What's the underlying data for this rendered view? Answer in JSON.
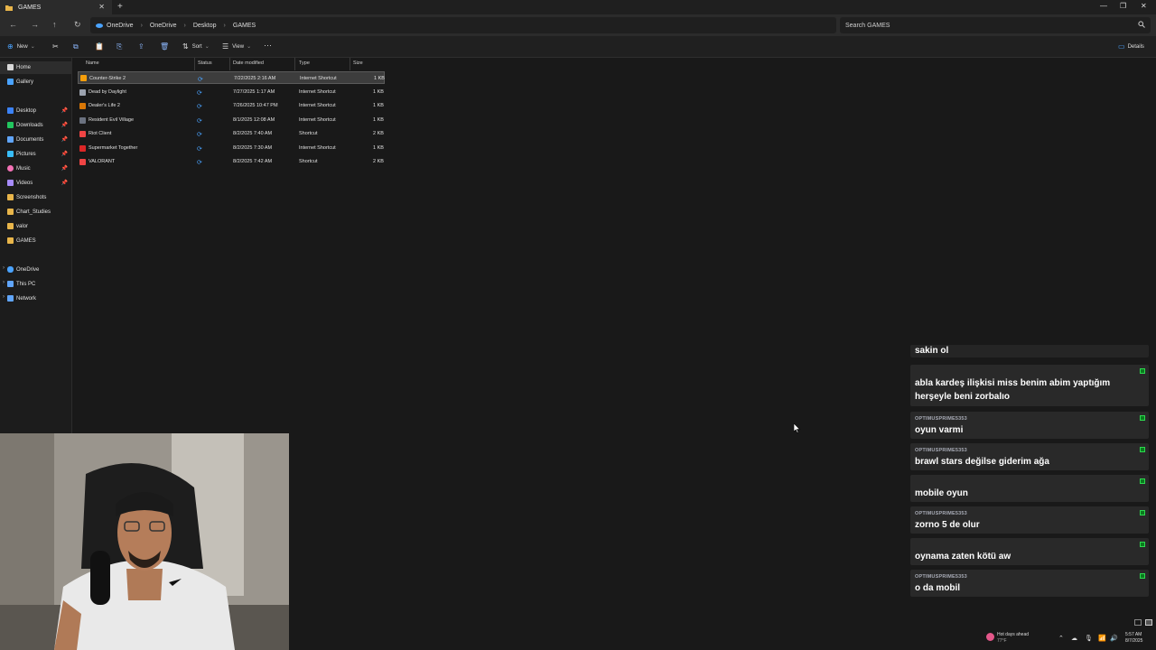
{
  "window": {
    "tab_title": "GAMES",
    "new_tab": "+",
    "tab_close": "✕",
    "minimize": "—",
    "maximize": "❐",
    "close": "✕"
  },
  "address": {
    "segments": [
      "OneDrive",
      "OneDrive",
      "Desktop",
      "GAMES"
    ],
    "search_placeholder": "Search GAMES"
  },
  "commands": {
    "new": "New",
    "sort": "Sort",
    "view": "View",
    "more": "···",
    "details": "Details"
  },
  "nav": {
    "items": [
      {
        "label": "Home",
        "color": "#d9d9d9"
      },
      {
        "label": "Gallery",
        "color": "#4aa3ff"
      },
      {
        "label": "Desktop",
        "color": "#3b82f6"
      },
      {
        "label": "Downloads",
        "color": "#22c55e"
      },
      {
        "label": "Documents",
        "color": "#60a5fa"
      },
      {
        "label": "Pictures",
        "color": "#38bdf8"
      },
      {
        "label": "Music",
        "color": "#f472b6"
      },
      {
        "label": "Videos",
        "color": "#a78bfa"
      },
      {
        "label": "Screenshots",
        "color": "#e8b54a"
      },
      {
        "label": "Chart_Studies",
        "color": "#e8b54a"
      },
      {
        "label": "valor",
        "color": "#e8b54a"
      },
      {
        "label": "GAMES",
        "color": "#e8b54a"
      },
      {
        "label": "OneDrive",
        "color": "#4aa3ff"
      },
      {
        "label": "This PC",
        "color": "#60a5fa"
      },
      {
        "label": "Network",
        "color": "#60a5fa"
      }
    ]
  },
  "columns": {
    "name": "Name",
    "status": "Status",
    "date": "Date modified",
    "type": "Type",
    "size": "Size"
  },
  "files": [
    {
      "name": "Counter-Strike 2",
      "date": "7/22/2025 2:16 AM",
      "type": "Internet Shortcut",
      "size": "1 KB",
      "color": "#f59e0b"
    },
    {
      "name": "Dead by Daylight",
      "date": "7/27/2025 1:17 AM",
      "type": "Internet Shortcut",
      "size": "1 KB",
      "color": "#9ca3af"
    },
    {
      "name": "Dealer's Life 2",
      "date": "7/26/2025 10:47 PM",
      "type": "Internet Shortcut",
      "size": "1 KB",
      "color": "#d97706"
    },
    {
      "name": "Resident Evil Village",
      "date": "8/1/2025 12:08 AM",
      "type": "Internet Shortcut",
      "size": "1 KB",
      "color": "#6b7280"
    },
    {
      "name": "Riot Client",
      "date": "8/2/2025 7:40 AM",
      "type": "Shortcut",
      "size": "2 KB",
      "color": "#ef4444"
    },
    {
      "name": "Supermarket Together",
      "date": "8/2/2025 7:30 AM",
      "type": "Internet Shortcut",
      "size": "1 KB",
      "color": "#dc2626"
    },
    {
      "name": "VALORANT",
      "date": "8/2/2025 7:42 AM",
      "type": "Shortcut",
      "size": "2 KB",
      "color": "#ef4444"
    }
  ],
  "chat": {
    "partial_top": "sakin ol",
    "messages": [
      {
        "user": "",
        "user_red": true,
        "text": "abla kardeş ilişkisi miss benim abim yaptığım herşeyle beni zorbalıo"
      },
      {
        "user": "OPTIMUSPRIME5353",
        "user_red": false,
        "text": "oyun varmi"
      },
      {
        "user": "OPTIMUSPRIME5353",
        "user_red": false,
        "text": "brawl stars değilse giderim ağa"
      },
      {
        "user": "",
        "user_red": true,
        "text": "mobile oyun"
      },
      {
        "user": "OPTIMUSPRIME5353",
        "user_red": false,
        "text": "zorno 5 de olur"
      },
      {
        "user": "",
        "user_red": true,
        "text": "oynama zaten kötü aw"
      },
      {
        "user": "OPTIMUSPRIME5353",
        "user_red": false,
        "text": "o da mobil"
      }
    ]
  },
  "tray": {
    "weather_title": "Hot days ahead",
    "weather_temp": "77°F",
    "time": "5:57 AM",
    "date": "8/7/2025"
  }
}
